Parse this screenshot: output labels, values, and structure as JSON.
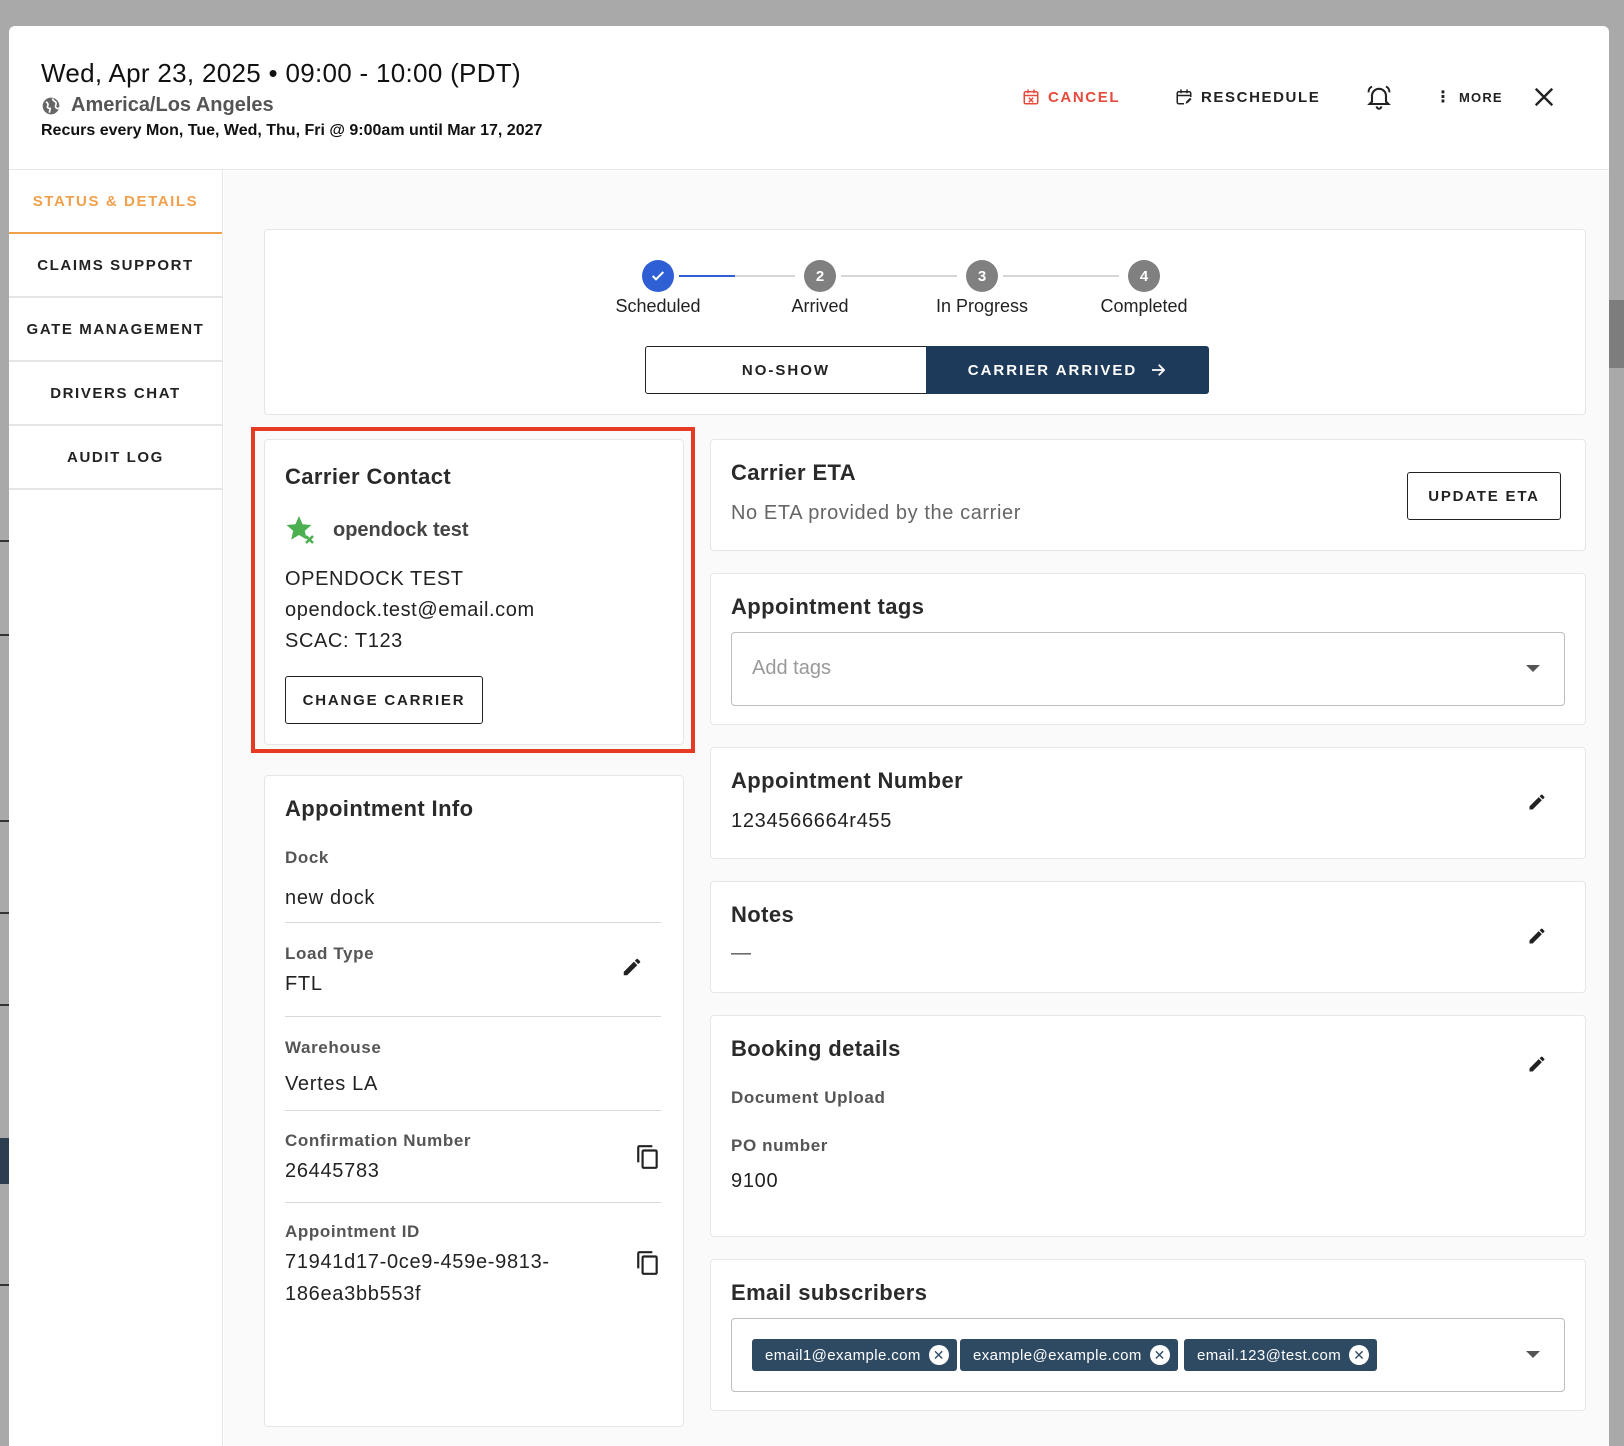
{
  "header": {
    "title": "Wed, Apr 23, 2025 • 09:00 - 10:00 (PDT)",
    "timezone": "America/Los Angeles",
    "recurrence": "Recurs every Mon, Tue, Wed, Thu, Fri @ 9:00am until Mar 17, 2027",
    "cancel_label": "CANCEL",
    "reschedule_label": "RESCHEDULE",
    "more_label": "MORE"
  },
  "sidebar": {
    "items": [
      {
        "label": "STATUS & DETAILS",
        "active": true
      },
      {
        "label": "CLAIMS SUPPORT"
      },
      {
        "label": "GATE MANAGEMENT"
      },
      {
        "label": "DRIVERS CHAT"
      },
      {
        "label": "AUDIT LOG"
      }
    ]
  },
  "stepper": {
    "steps": [
      {
        "number": "",
        "label": "Scheduled",
        "done": true
      },
      {
        "number": "2",
        "label": "Arrived"
      },
      {
        "number": "3",
        "label": "In Progress"
      },
      {
        "number": "4",
        "label": "Completed"
      }
    ],
    "no_show_label": "NO-SHOW",
    "carrier_arrived_label": "CARRIER ARRIVED"
  },
  "carrier_contact": {
    "title": "Carrier Contact",
    "name": "opendock test",
    "company": "OPENDOCK TEST",
    "email": "opendock.test@email.com",
    "scac": "SCAC: T123",
    "change_label": "CHANGE CARRIER"
  },
  "appointment_info": {
    "title": "Appointment Info",
    "dock_label": "Dock",
    "dock_value": "new dock",
    "load_type_label": "Load Type",
    "load_type_value": "FTL",
    "warehouse_label": "Warehouse",
    "warehouse_value": "Vertes LA",
    "confirmation_label": "Confirmation Number",
    "confirmation_value": "26445783",
    "appointment_id_label": "Appointment ID",
    "appointment_id_line1": "71941d17-0ce9-459e-9813-",
    "appointment_id_line2": "186ea3bb553f"
  },
  "carrier_eta": {
    "title": "Carrier ETA",
    "text": "No ETA provided by the carrier",
    "update_label": "UPDATE ETA"
  },
  "tags": {
    "title": "Appointment tags",
    "placeholder": "Add tags"
  },
  "appointment_number": {
    "title": "Appointment Number",
    "value": "1234566664r455"
  },
  "notes": {
    "title": "Notes",
    "value": "—"
  },
  "booking": {
    "title": "Booking details",
    "document_label": "Document Upload",
    "po_label": "PO number",
    "po_value": "9100"
  },
  "subscribers": {
    "title": "Email subscribers",
    "emails": [
      "email1@example.com",
      "example@example.com",
      "email.123@test.com"
    ]
  },
  "colors": {
    "accent": "#f0a04b",
    "danger": "#e64a3c",
    "primary": "#1e3a5a",
    "step_active": "#2f5fd4",
    "highlight": "#e63a23"
  }
}
